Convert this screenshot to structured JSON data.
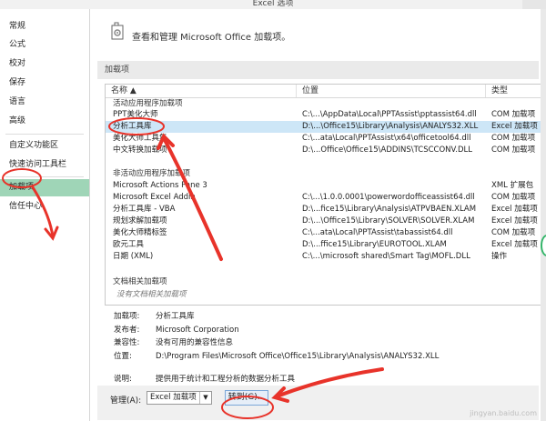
{
  "window": {
    "title": "Excel 选项"
  },
  "sidebar": {
    "items": [
      {
        "label": "常规"
      },
      {
        "label": "公式"
      },
      {
        "label": "校对"
      },
      {
        "label": "保存"
      },
      {
        "label": "语言"
      },
      {
        "label": "高级"
      },
      {
        "label": "自定义功能区"
      },
      {
        "label": "快速访问工具栏"
      },
      {
        "label": "加载项",
        "active": true
      },
      {
        "label": "信任中心"
      }
    ]
  },
  "header": {
    "text": "查看和管理 Microsoft Office 加载项。"
  },
  "section": {
    "title": "加载项"
  },
  "table": {
    "columns": [
      "名称 ▲",
      "位置",
      "类型"
    ],
    "groups": [
      {
        "title": "活动应用程序加载项",
        "rows": [
          {
            "name": "PPT美化大师",
            "location": "C:\\...\\AppData\\Local\\PPTAssist\\pptassist64.dll",
            "type": "COM 加载项"
          },
          {
            "name": "分析工具库",
            "location": "D:\\...\\Office15\\Library\\Analysis\\ANALYS32.XLL",
            "type": "Excel 加载项",
            "selected": true
          },
          {
            "name": "美化大师工具集",
            "location": "C:\\...ata\\Local\\PPTAssist\\x64\\officetool64.dll",
            "type": "COM 加载项"
          },
          {
            "name": "中文转换加载项",
            "location": "D:\\...Office\\Office15\\ADDINS\\TCSCCONV.DLL",
            "type": "COM 加载项"
          }
        ]
      },
      {
        "title": "非活动应用程序加载项",
        "rows": [
          {
            "name": "Microsoft Actions Pane 3",
            "location": "",
            "type": "XML 扩展包"
          },
          {
            "name": "Microsoft Excel Addin",
            "location": "C:\\...\\1.0.0.0001\\powerwordofficeassist64.dll",
            "type": "COM 加载项"
          },
          {
            "name": "分析工具库 - VBA",
            "location": "D:\\...fice15\\Library\\Analysis\\ATPVBAEN.XLAM",
            "type": "Excel 加载项"
          },
          {
            "name": "规划求解加载项",
            "location": "D:\\...\\Office15\\Library\\SOLVER\\SOLVER.XLAM",
            "type": "Excel 加载项"
          },
          {
            "name": "美化大师精标签",
            "location": "C:\\...ata\\Local\\PPTAssist\\tabassist64.dll",
            "type": "COM 加载项"
          },
          {
            "name": "欧元工具",
            "location": "D:\\...ffice15\\Library\\EUROTOOL.XLAM",
            "type": "Excel 加载项"
          },
          {
            "name": "日期 (XML)",
            "location": "C:\\...\\microsoft shared\\Smart Tag\\MOFL.DLL",
            "type": "操作"
          }
        ]
      },
      {
        "title": "文档相关加载项",
        "empty_note": "没有文档相关加载项"
      }
    ]
  },
  "details": {
    "addin": {
      "label": "加载项:",
      "value": "分析工具库"
    },
    "publisher": {
      "label": "发布者:",
      "value": "Microsoft Corporation"
    },
    "compat": {
      "label": "兼容性:",
      "value": "没有可用的兼容性信息"
    },
    "location": {
      "label": "位置:",
      "value": "D:\\Program Files\\Microsoft Office\\Office15\\Library\\Analysis\\ANALYS32.XLL"
    },
    "desc": {
      "label": "说明:",
      "value": "提供用于统计和工程分析的数据分析工具"
    }
  },
  "manage": {
    "label": "管理(A):",
    "select_value": "Excel 加载项",
    "go_button": "转到(G)..."
  },
  "watermark": "jingyan.baidu.com",
  "colors": {
    "active_sidebar": "#9fd5b7",
    "selected_row": "#cde6f7",
    "annotation": "#e8332a"
  }
}
